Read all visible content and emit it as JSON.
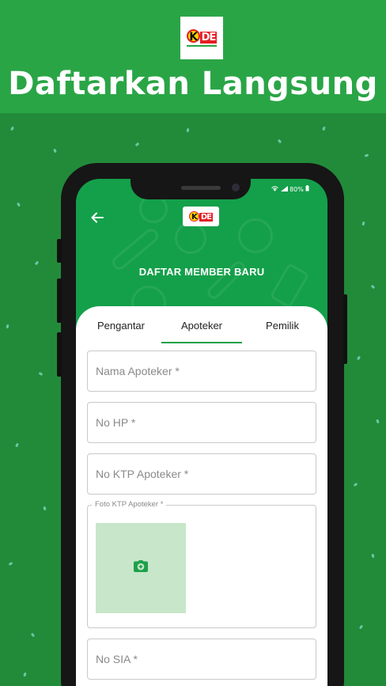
{
  "banner": {
    "logo_text_k": "K",
    "logo_text_de": "DE",
    "headline": "Daftarkan Langsung"
  },
  "status_bar": {
    "battery": "80%"
  },
  "app": {
    "logo_text_k": "K",
    "logo_text_de": "DE",
    "title": "DAFTAR MEMBER BARU"
  },
  "tabs": [
    {
      "label": "Pengantar",
      "active": false
    },
    {
      "label": "Apoteker",
      "active": true
    },
    {
      "label": "Pemilik",
      "active": false
    }
  ],
  "form": {
    "nama_apoteker": {
      "placeholder": "Nama Apoteker *",
      "value": ""
    },
    "no_hp": {
      "placeholder": "No HP *",
      "value": ""
    },
    "no_ktp": {
      "placeholder": "No KTP Apoteker *",
      "value": ""
    },
    "foto_ktp": {
      "label": "Foto KTP Apoteker *"
    },
    "no_sia": {
      "placeholder": "No SIA *",
      "value": ""
    }
  },
  "colors": {
    "banner_green": "#2aa546",
    "background_green": "#228b3a",
    "app_green": "#14a04a",
    "accent_green": "#1da04a",
    "photo_placeholder": "#c8e6c9"
  },
  "icons": [
    "back-arrow-icon",
    "camera-add-icon",
    "wifi-icon",
    "signal-icon",
    "battery-icon"
  ]
}
